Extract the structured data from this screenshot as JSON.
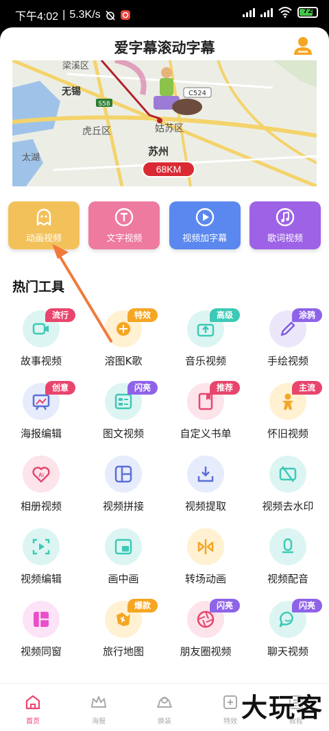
{
  "status": {
    "time": "下午4:02",
    "speed": "5.3K/s",
    "battery": "72"
  },
  "header": {
    "title": "爱字幕滚动字幕"
  },
  "banner": {
    "places": [
      "梁溪区",
      "无锡",
      "虎丘区",
      "姑苏区",
      "苏州",
      "太湖",
      "C524",
      "S58"
    ],
    "distance": "68KM"
  },
  "features": [
    {
      "label": "动画视频",
      "color": "#f3c15a",
      "icon": "ghost-icon"
    },
    {
      "label": "文字视频",
      "color": "#ee7aa0",
      "icon": "text-t-icon"
    },
    {
      "label": "视频加字幕",
      "color": "#5b88ee",
      "icon": "play-icon"
    },
    {
      "label": "歌词视频",
      "color": "#9d62e6",
      "icon": "music-note-icon"
    }
  ],
  "section": {
    "title": "热门工具"
  },
  "tools": [
    {
      "label": "故事视频",
      "badge": "流行",
      "icon": "story-video-icon"
    },
    {
      "label": "溶图K歌",
      "badge": "特效",
      "icon": "karaoke-icon"
    },
    {
      "label": "音乐视频",
      "badge": "高级",
      "icon": "music-video-icon"
    },
    {
      "label": "手绘视频",
      "badge": "涂鸦",
      "icon": "pen-icon"
    },
    {
      "label": "海报编辑",
      "badge": "创意",
      "icon": "poster-icon"
    },
    {
      "label": "图文视频",
      "badge": "闪亮",
      "icon": "image-text-icon"
    },
    {
      "label": "自定义书单",
      "badge": "推荐",
      "icon": "book-icon"
    },
    {
      "label": "怀旧视频",
      "badge": "主流",
      "icon": "gingerbread-icon"
    },
    {
      "label": "相册视频",
      "badge": "",
      "icon": "ai-album-icon"
    },
    {
      "label": "视频拼接",
      "badge": "",
      "icon": "splice-icon"
    },
    {
      "label": "视频提取",
      "badge": "",
      "icon": "download-icon"
    },
    {
      "label": "视频去水印",
      "badge": "",
      "icon": "no-watermark-icon"
    },
    {
      "label": "视频编辑",
      "badge": "",
      "icon": "video-edit-icon"
    },
    {
      "label": "画中画",
      "badge": "",
      "icon": "picture-in-picture-icon"
    },
    {
      "label": "转场动画",
      "badge": "",
      "icon": "transition-icon"
    },
    {
      "label": "视频配音",
      "badge": "",
      "icon": "microphone-icon"
    },
    {
      "label": "视频同窗",
      "badge": "",
      "icon": "layout-icon"
    },
    {
      "label": "旅行地图",
      "badge": "爆款",
      "icon": "travel-map-icon"
    },
    {
      "label": "朋友圈视频",
      "badge": "闪亮",
      "icon": "shutter-icon"
    },
    {
      "label": "聊天视频",
      "badge": "闪亮",
      "icon": "chat-bubble-icon"
    }
  ],
  "nav": [
    {
      "label": "首页",
      "active": true,
      "icon": "home-icon"
    },
    {
      "label": "海报",
      "active": false,
      "icon": "crown-icon"
    },
    {
      "label": "换装",
      "active": false,
      "icon": "costume-icon"
    },
    {
      "label": "特效",
      "active": false,
      "icon": "effects-icon"
    },
    {
      "label": "教程",
      "active": false,
      "icon": "tutorial-icon"
    }
  ],
  "watermark": "大玩客"
}
